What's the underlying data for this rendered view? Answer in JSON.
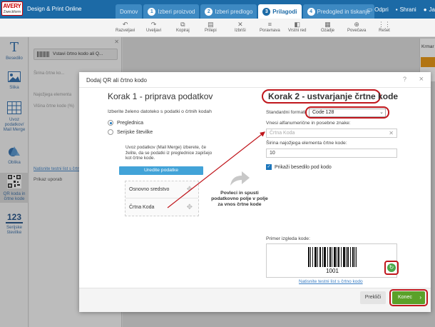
{
  "header": {
    "logo_line1": "AVERY",
    "logo_line2": "Zweckform",
    "app_title": "Design & Print Online",
    "steps": [
      {
        "num": "",
        "label": "Domov"
      },
      {
        "num": "1",
        "label": "Izberi proizvod"
      },
      {
        "num": "2",
        "label": "Izberi predlogo"
      },
      {
        "num": "3",
        "label": "Prilagodi"
      },
      {
        "num": "4",
        "label": "Predogled in tiskanje"
      }
    ],
    "actions": [
      "Odpri",
      "Shrani",
      "Ja"
    ]
  },
  "toolbar": {
    "items": [
      "Razveljavi",
      "Uveljavi",
      "Kopiraj",
      "Prilepi",
      "Izbriši",
      "Poravnava",
      "Vrstni red",
      "Ozadje",
      "Povečava",
      "Rešet"
    ]
  },
  "left_rail": {
    "items": [
      "Besedilo",
      "Slika",
      "Uvoz podatkov/ Mail Merge",
      "Oblika",
      "QR koda in črtne kode",
      "Serijske številke"
    ],
    "serial_number": "123"
  },
  "side_panel": {
    "bar_label": "Vstavi črtno kodo ali Q...",
    "fields": [
      "Širina črtne ko...",
      "Najožjega elementa",
      "Višina črtne kode (%)"
    ],
    "link": "Natisnite testni list s črtnimi",
    "prikaz": "Prikaz uporab"
  },
  "right_panel": {
    "label": "Krmar"
  },
  "modal": {
    "title": "Dodaj QR ali črtno kodo",
    "help": "?",
    "close": "×",
    "left": {
      "heading": "Korak 1 - priprava podatkov",
      "intro": "Izberite želeno datoteko s podatki o črtnih kodah",
      "radio_table": "Preglednica",
      "radio_serial": "Serijske številke",
      "mail_merge_text": "Uvoz podatkov (Mail Merge) izberete, če želite, da se podatki iz preglednice zapišejo kot črtne kode.",
      "edit_button": "Uredite podatke",
      "fields": [
        "Osnovno sredstvo",
        "Črtna Koda"
      ],
      "drag_hint": "Povleci in spusti podatkovno polje v polje za vnos črtne kode"
    },
    "right": {
      "heading": "Korak 2 - ustvarjanje črtne kode",
      "standard_label": "Standardni formati",
      "standard_value": "Code 128",
      "alnum_label": "Vnesi alfanumerične in posebne znake:",
      "alnum_value": "Črtna Koda",
      "narrow_label": "Širina najožjega elementa črtne kode:",
      "narrow_value": "10",
      "show_text_label": "Prikaži besedilo pod kodo",
      "sample_label": "Primer izgleda kode:",
      "sample_number": "1001",
      "test_link": "Natisnite testni list s črtno kodo"
    },
    "footer": {
      "prev": "Prekliči",
      "next": "Konec"
    }
  },
  "colors": {
    "brand_blue": "#1c6aa6",
    "accent_green": "#5aa129",
    "annotation_red": "#c0161c",
    "link_blue": "#3a7ec4",
    "button_blue": "#42a3d8"
  }
}
